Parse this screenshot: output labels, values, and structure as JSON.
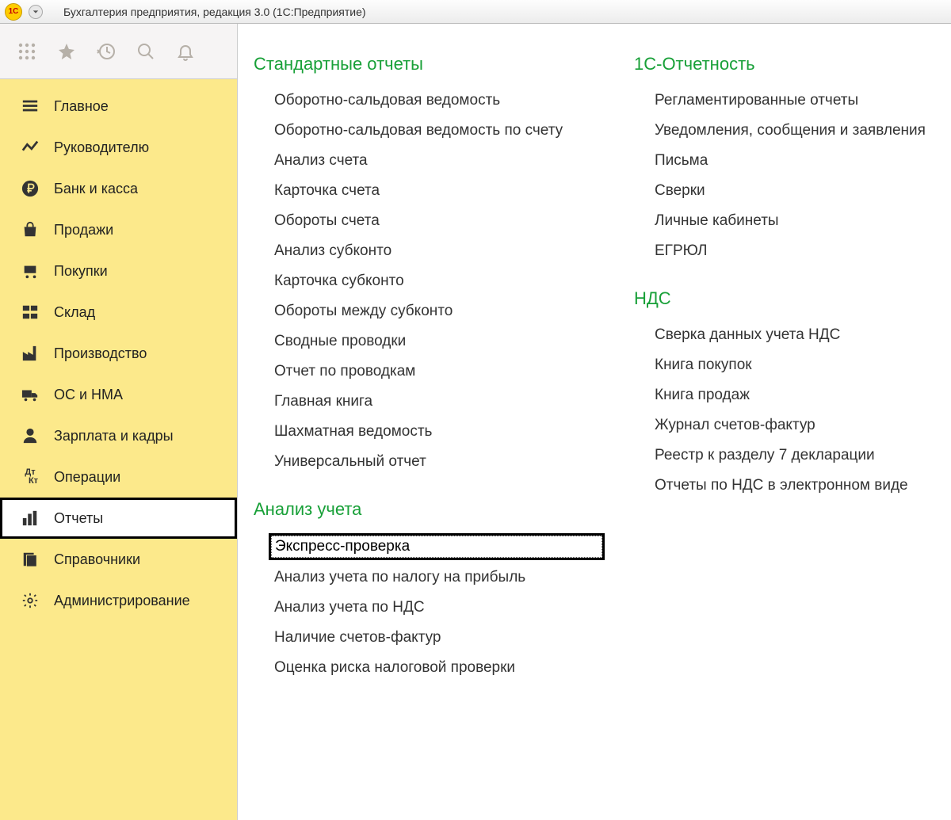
{
  "titlebar": {
    "logo_text": "1C",
    "title": "Бухгалтерия предприятия, редакция 3.0  (1С:Предприятие)"
  },
  "sidebar": {
    "items": [
      {
        "label": "Главное"
      },
      {
        "label": "Руководителю"
      },
      {
        "label": "Банк и касса"
      },
      {
        "label": "Продажи"
      },
      {
        "label": "Покупки"
      },
      {
        "label": "Склад"
      },
      {
        "label": "Производство"
      },
      {
        "label": "ОС и НМА"
      },
      {
        "label": "Зарплата и кадры"
      },
      {
        "label": "Операции"
      },
      {
        "label": "Отчеты"
      },
      {
        "label": "Справочники"
      },
      {
        "label": "Администрирование"
      }
    ]
  },
  "content": {
    "columns": [
      {
        "sections": [
          {
            "title": "Стандартные отчеты",
            "items": [
              "Оборотно-сальдовая ведомость",
              "Оборотно-сальдовая ведомость по счету",
              "Анализ счета",
              "Карточка счета",
              "Обороты счета",
              "Анализ субконто",
              "Карточка субконто",
              "Обороты между субконто",
              "Сводные проводки",
              "Отчет по проводкам",
              "Главная книга",
              "Шахматная ведомость",
              "Универсальный отчет"
            ]
          },
          {
            "title": "Анализ учета",
            "highlighted_item": "Экспресс-проверка",
            "items": [
              "Анализ учета по налогу на прибыль",
              "Анализ учета по НДС",
              "Наличие счетов-фактур",
              "Оценка риска налоговой проверки"
            ]
          }
        ]
      },
      {
        "sections": [
          {
            "title": "1С-Отчетность",
            "items": [
              "Регламентированные отчеты",
              "Уведомления, сообщения и заявления",
              "Письма",
              "Сверки",
              "Личные кабинеты",
              "ЕГРЮЛ"
            ]
          },
          {
            "title": "НДС",
            "items": [
              "Сверка данных учета НДС",
              "Книга покупок",
              "Книга продаж",
              "Журнал счетов-фактур",
              "Реестр к разделу 7 декларации",
              "Отчеты по НДС в электронном виде"
            ]
          }
        ]
      }
    ]
  }
}
